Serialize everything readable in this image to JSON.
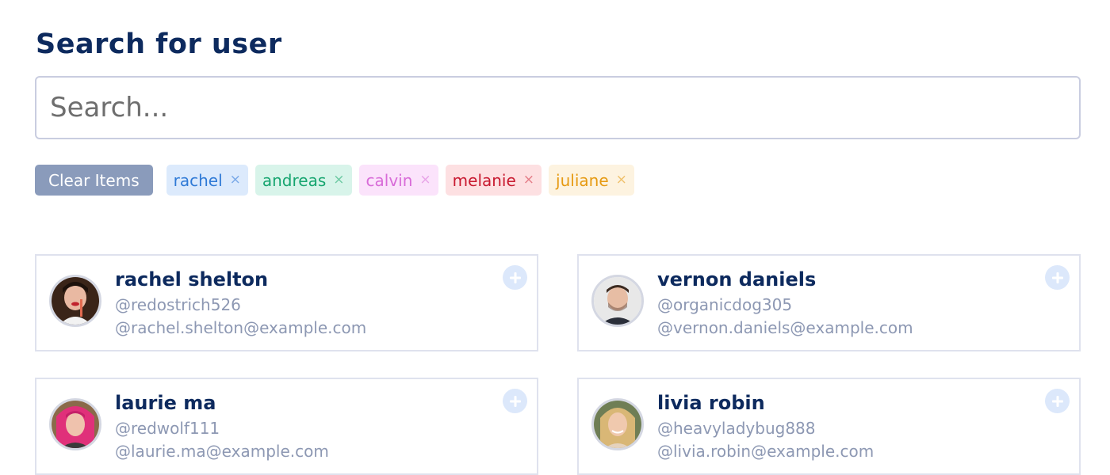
{
  "title": "Search for user",
  "search": {
    "placeholder": "Search..."
  },
  "clear_button_label": "Clear Items",
  "chips": [
    {
      "label": "rachel",
      "bg": "#dceafc",
      "color": "#2f7ad6",
      "x_color": "#78a8e8"
    },
    {
      "label": "andreas",
      "bg": "#d8f4ea",
      "color": "#16a56f",
      "x_color": "#6cc9a2"
    },
    {
      "label": "calvin",
      "bg": "#fbe3fb",
      "color": "#d86bd8",
      "x_color": "#e7a3e7"
    },
    {
      "label": "melanie",
      "bg": "#fde0e2",
      "color": "#c8192f",
      "x_color": "#e47b86"
    },
    {
      "label": "juliane",
      "bg": "#fdf3e0",
      "color": "#e69a12",
      "x_color": "#efc06a"
    }
  ],
  "chip_remove_symbol": "×",
  "users": [
    {
      "name": "rachel shelton",
      "handle": "@redostrich526",
      "email": "@rachel.shelton@example.com",
      "avatar": "rachel-avatar"
    },
    {
      "name": "vernon daniels",
      "handle": "@organicdog305",
      "email": "@vernon.daniels@example.com",
      "avatar": "vernon-avatar"
    },
    {
      "name": "laurie ma",
      "handle": "@redwolf111",
      "email": "@laurie.ma@example.com",
      "avatar": "laurie-avatar"
    },
    {
      "name": "livia robin",
      "handle": "@heavyladybug888",
      "email": "@livia.robin@example.com",
      "avatar": "livia-avatar"
    }
  ],
  "colors": {
    "title": "#0d2a5e",
    "muted": "#8d98b3",
    "clear_button": "#8a9bbb",
    "add_button_bg": "#dce8fb",
    "add_button_icon": "#ffffff"
  },
  "icons": {
    "add": "plus-circle-icon",
    "remove": "close-icon"
  }
}
